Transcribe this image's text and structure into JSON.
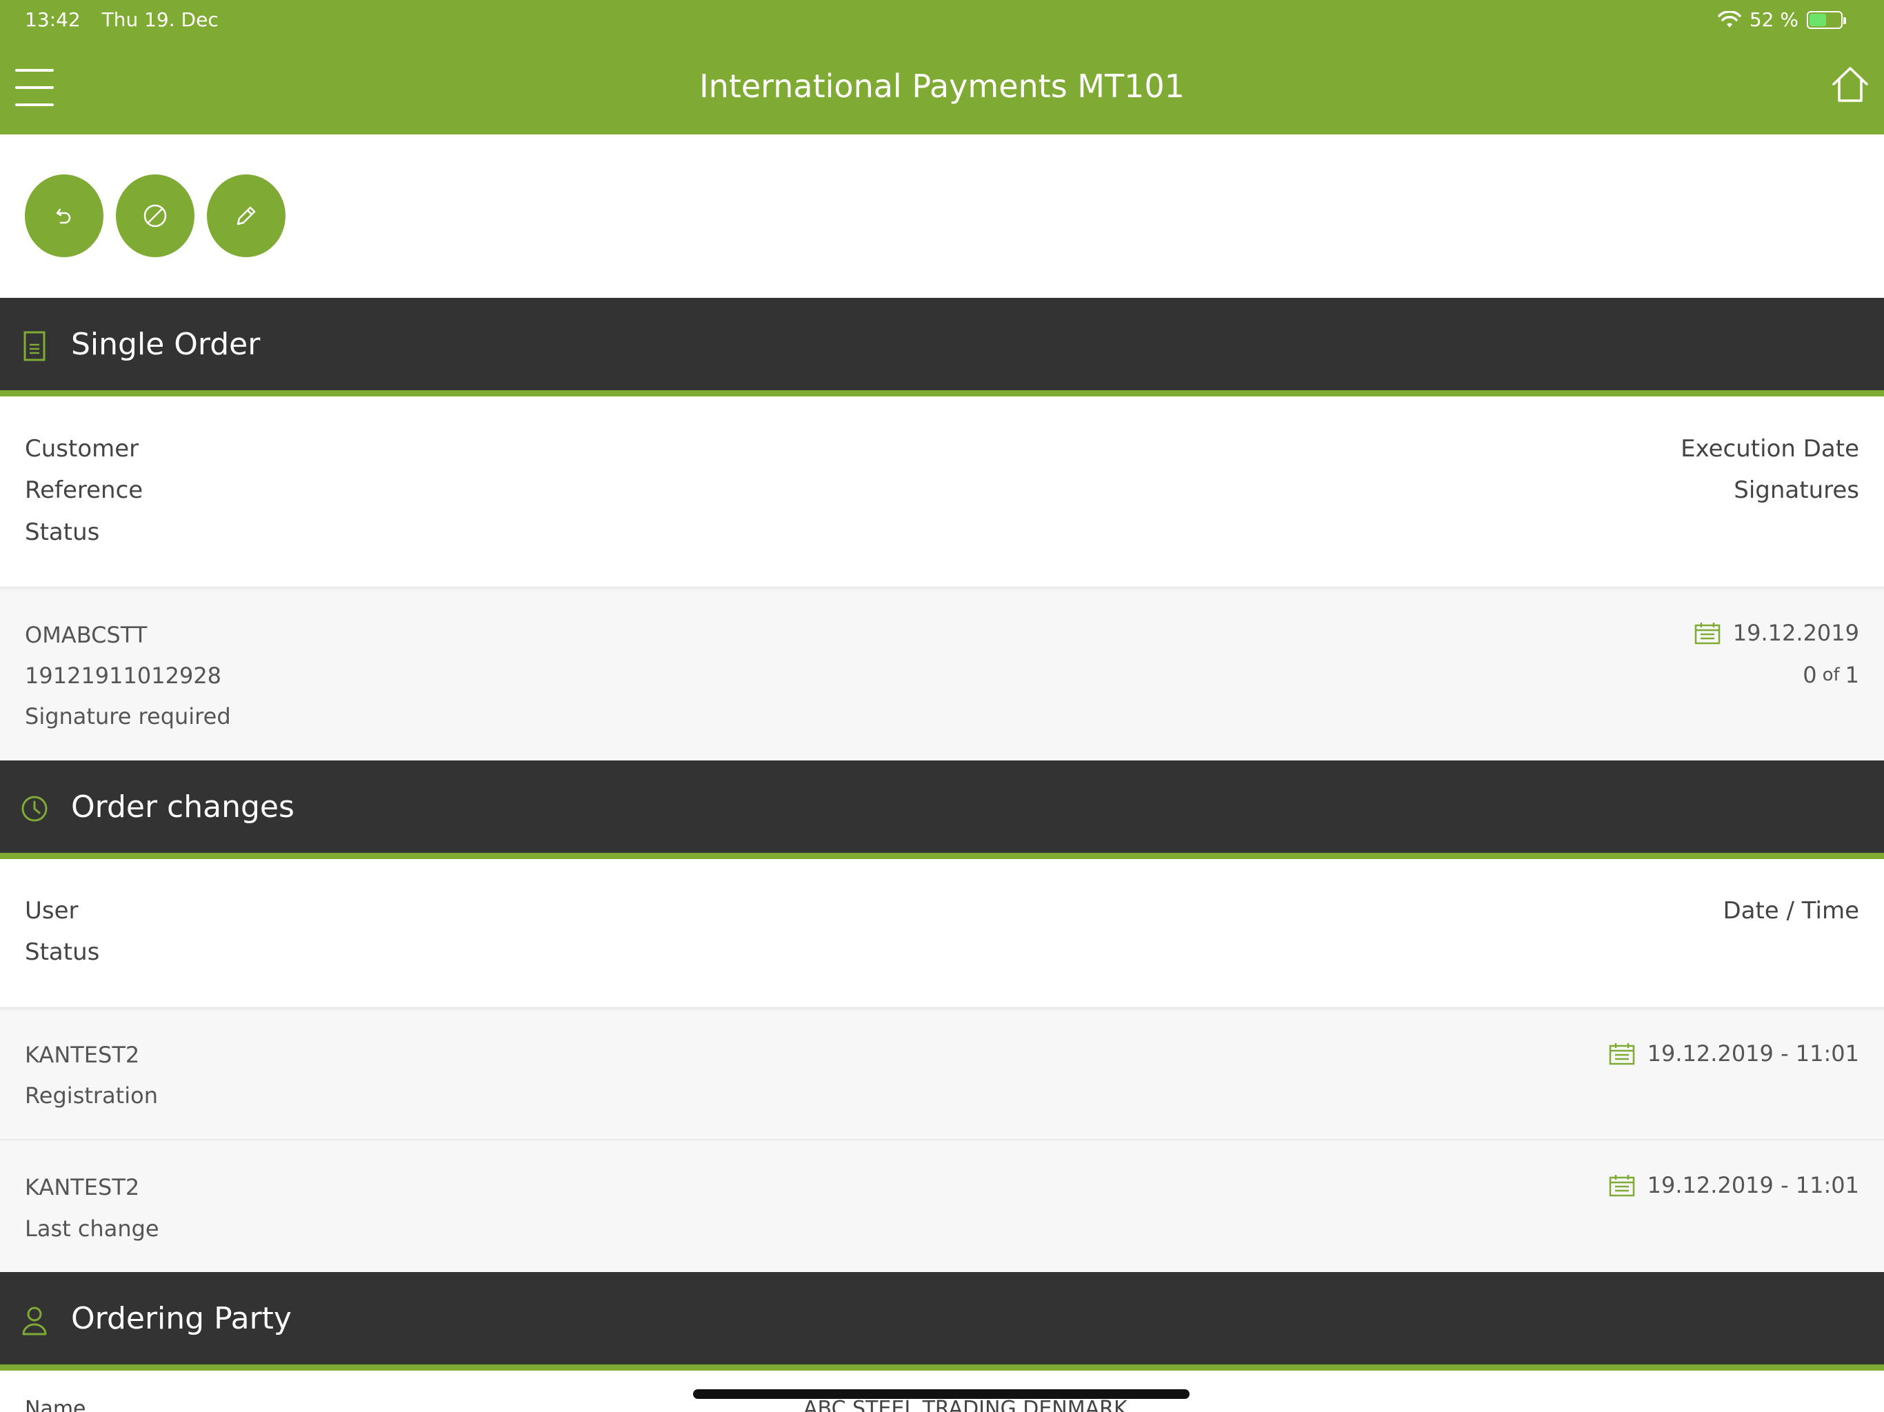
{
  "status_bar": {
    "time": "13:42",
    "date": "Thu 19. Dec",
    "battery": "52 %"
  },
  "nav": {
    "title": "International Payments MT101"
  },
  "single_order": {
    "title": "Single Order",
    "labels": {
      "customer": "Customer",
      "reference": "Reference",
      "status": "Status",
      "execution_date": "Execution Date",
      "signatures": "Signatures"
    },
    "values": {
      "customer": "OMABCSTT",
      "reference": "19121911012928",
      "status": "Signature required",
      "execution_date": "19.12.2019",
      "signatures_count": "0",
      "signatures_of": "of",
      "signatures_total": "1"
    }
  },
  "order_changes": {
    "title": "Order changes",
    "labels": {
      "user": "User",
      "status": "Status",
      "datetime": "Date / Time"
    },
    "rows": [
      {
        "user": "KANTEST2",
        "status": "Registration",
        "datetime": "19.12.2019 - 11:01"
      },
      {
        "user": "KANTEST2",
        "status": "Last change",
        "datetime": "19.12.2019 - 11:01"
      }
    ]
  },
  "ordering_party": {
    "title": "Ordering Party",
    "peek_label": "Name",
    "peek_value": "ABC STEEL TRADING DENMARK"
  },
  "icons": {
    "menu": "hamburger-icon",
    "home": "home-icon",
    "undo": "undo-icon",
    "cancel": "cancel-icon",
    "edit": "pencil-icon",
    "document": "document-icon",
    "clock": "clock-icon",
    "person": "person-icon",
    "calendar": "calendar-icon"
  },
  "colors": {
    "accent": "#7fab35",
    "header_dark": "#333333"
  }
}
